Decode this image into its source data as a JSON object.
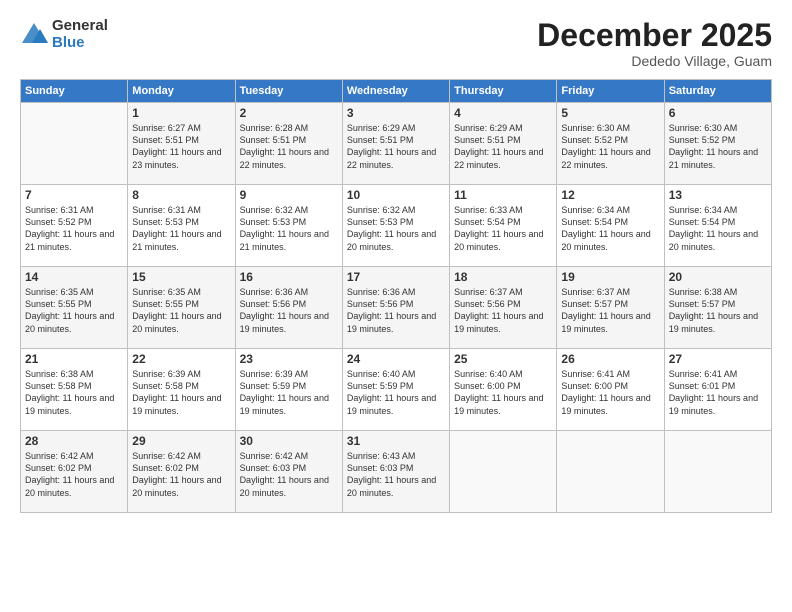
{
  "logo": {
    "general": "General",
    "blue": "Blue"
  },
  "header": {
    "month": "December 2025",
    "location": "Dededo Village, Guam"
  },
  "days": [
    "Sunday",
    "Monday",
    "Tuesday",
    "Wednesday",
    "Thursday",
    "Friday",
    "Saturday"
  ],
  "weeks": [
    [
      {
        "day": "",
        "sunrise": "",
        "sunset": "",
        "daylight": ""
      },
      {
        "day": "1",
        "sunrise": "Sunrise: 6:27 AM",
        "sunset": "Sunset: 5:51 PM",
        "daylight": "Daylight: 11 hours and 23 minutes."
      },
      {
        "day": "2",
        "sunrise": "Sunrise: 6:28 AM",
        "sunset": "Sunset: 5:51 PM",
        "daylight": "Daylight: 11 hours and 22 minutes."
      },
      {
        "day": "3",
        "sunrise": "Sunrise: 6:29 AM",
        "sunset": "Sunset: 5:51 PM",
        "daylight": "Daylight: 11 hours and 22 minutes."
      },
      {
        "day": "4",
        "sunrise": "Sunrise: 6:29 AM",
        "sunset": "Sunset: 5:51 PM",
        "daylight": "Daylight: 11 hours and 22 minutes."
      },
      {
        "day": "5",
        "sunrise": "Sunrise: 6:30 AM",
        "sunset": "Sunset: 5:52 PM",
        "daylight": "Daylight: 11 hours and 22 minutes."
      },
      {
        "day": "6",
        "sunrise": "Sunrise: 6:30 AM",
        "sunset": "Sunset: 5:52 PM",
        "daylight": "Daylight: 11 hours and 21 minutes."
      }
    ],
    [
      {
        "day": "7",
        "sunrise": "Sunrise: 6:31 AM",
        "sunset": "Sunset: 5:52 PM",
        "daylight": "Daylight: 11 hours and 21 minutes."
      },
      {
        "day": "8",
        "sunrise": "Sunrise: 6:31 AM",
        "sunset": "Sunset: 5:53 PM",
        "daylight": "Daylight: 11 hours and 21 minutes."
      },
      {
        "day": "9",
        "sunrise": "Sunrise: 6:32 AM",
        "sunset": "Sunset: 5:53 PM",
        "daylight": "Daylight: 11 hours and 21 minutes."
      },
      {
        "day": "10",
        "sunrise": "Sunrise: 6:32 AM",
        "sunset": "Sunset: 5:53 PM",
        "daylight": "Daylight: 11 hours and 20 minutes."
      },
      {
        "day": "11",
        "sunrise": "Sunrise: 6:33 AM",
        "sunset": "Sunset: 5:54 PM",
        "daylight": "Daylight: 11 hours and 20 minutes."
      },
      {
        "day": "12",
        "sunrise": "Sunrise: 6:34 AM",
        "sunset": "Sunset: 5:54 PM",
        "daylight": "Daylight: 11 hours and 20 minutes."
      },
      {
        "day": "13",
        "sunrise": "Sunrise: 6:34 AM",
        "sunset": "Sunset: 5:54 PM",
        "daylight": "Daylight: 11 hours and 20 minutes."
      }
    ],
    [
      {
        "day": "14",
        "sunrise": "Sunrise: 6:35 AM",
        "sunset": "Sunset: 5:55 PM",
        "daylight": "Daylight: 11 hours and 20 minutes."
      },
      {
        "day": "15",
        "sunrise": "Sunrise: 6:35 AM",
        "sunset": "Sunset: 5:55 PM",
        "daylight": "Daylight: 11 hours and 20 minutes."
      },
      {
        "day": "16",
        "sunrise": "Sunrise: 6:36 AM",
        "sunset": "Sunset: 5:56 PM",
        "daylight": "Daylight: 11 hours and 19 minutes."
      },
      {
        "day": "17",
        "sunrise": "Sunrise: 6:36 AM",
        "sunset": "Sunset: 5:56 PM",
        "daylight": "Daylight: 11 hours and 19 minutes."
      },
      {
        "day": "18",
        "sunrise": "Sunrise: 6:37 AM",
        "sunset": "Sunset: 5:56 PM",
        "daylight": "Daylight: 11 hours and 19 minutes."
      },
      {
        "day": "19",
        "sunrise": "Sunrise: 6:37 AM",
        "sunset": "Sunset: 5:57 PM",
        "daylight": "Daylight: 11 hours and 19 minutes."
      },
      {
        "day": "20",
        "sunrise": "Sunrise: 6:38 AM",
        "sunset": "Sunset: 5:57 PM",
        "daylight": "Daylight: 11 hours and 19 minutes."
      }
    ],
    [
      {
        "day": "21",
        "sunrise": "Sunrise: 6:38 AM",
        "sunset": "Sunset: 5:58 PM",
        "daylight": "Daylight: 11 hours and 19 minutes."
      },
      {
        "day": "22",
        "sunrise": "Sunrise: 6:39 AM",
        "sunset": "Sunset: 5:58 PM",
        "daylight": "Daylight: 11 hours and 19 minutes."
      },
      {
        "day": "23",
        "sunrise": "Sunrise: 6:39 AM",
        "sunset": "Sunset: 5:59 PM",
        "daylight": "Daylight: 11 hours and 19 minutes."
      },
      {
        "day": "24",
        "sunrise": "Sunrise: 6:40 AM",
        "sunset": "Sunset: 5:59 PM",
        "daylight": "Daylight: 11 hours and 19 minutes."
      },
      {
        "day": "25",
        "sunrise": "Sunrise: 6:40 AM",
        "sunset": "Sunset: 6:00 PM",
        "daylight": "Daylight: 11 hours and 19 minutes."
      },
      {
        "day": "26",
        "sunrise": "Sunrise: 6:41 AM",
        "sunset": "Sunset: 6:00 PM",
        "daylight": "Daylight: 11 hours and 19 minutes."
      },
      {
        "day": "27",
        "sunrise": "Sunrise: 6:41 AM",
        "sunset": "Sunset: 6:01 PM",
        "daylight": "Daylight: 11 hours and 19 minutes."
      }
    ],
    [
      {
        "day": "28",
        "sunrise": "Sunrise: 6:42 AM",
        "sunset": "Sunset: 6:02 PM",
        "daylight": "Daylight: 11 hours and 20 minutes."
      },
      {
        "day": "29",
        "sunrise": "Sunrise: 6:42 AM",
        "sunset": "Sunset: 6:02 PM",
        "daylight": "Daylight: 11 hours and 20 minutes."
      },
      {
        "day": "30",
        "sunrise": "Sunrise: 6:42 AM",
        "sunset": "Sunset: 6:03 PM",
        "daylight": "Daylight: 11 hours and 20 minutes."
      },
      {
        "day": "31",
        "sunrise": "Sunrise: 6:43 AM",
        "sunset": "Sunset: 6:03 PM",
        "daylight": "Daylight: 11 hours and 20 minutes."
      },
      {
        "day": "",
        "sunrise": "",
        "sunset": "",
        "daylight": ""
      },
      {
        "day": "",
        "sunrise": "",
        "sunset": "",
        "daylight": ""
      },
      {
        "day": "",
        "sunrise": "",
        "sunset": "",
        "daylight": ""
      }
    ]
  ]
}
